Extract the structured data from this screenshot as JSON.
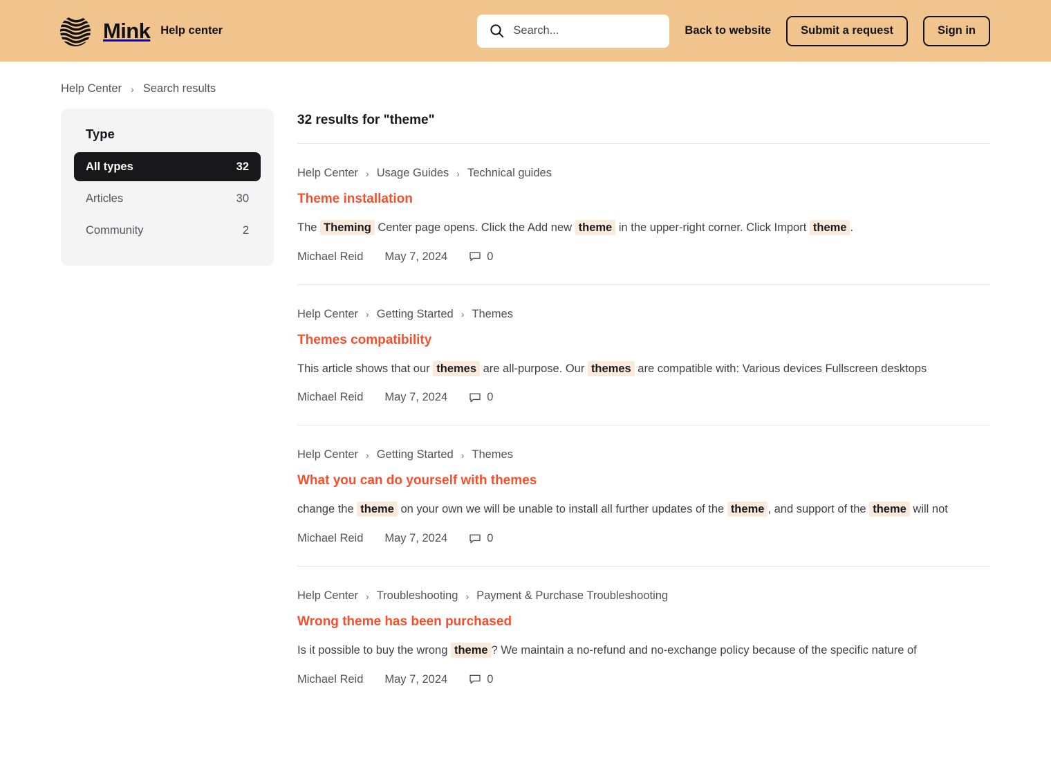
{
  "theme": {
    "header_bg": "#F2C48D",
    "accent_link": "#F4502D",
    "highlight_bg": "#FAEADB",
    "active_facet_bg": "#18181B",
    "sidebar_bg": "#F4F4F5",
    "divider": "#E4E4E7"
  },
  "header": {
    "brand_name": "Mink",
    "brand_logo_icon": "mink-wave-globe-logo",
    "help_center_label": "Help center",
    "search": {
      "icon": "search-icon",
      "placeholder": "Search...",
      "value": ""
    },
    "back_to_website_label": "Back to website",
    "submit_request_label": "Submit a request",
    "sign_in_label": "Sign in"
  },
  "breadcrumb": {
    "items": [
      {
        "label": "Help Center"
      },
      {
        "label": "Search results"
      }
    ],
    "separator": "›"
  },
  "sidebar": {
    "title": "Type",
    "facets": [
      {
        "label": "All types",
        "count": "32",
        "active": true
      },
      {
        "label": "Articles",
        "count": "30",
        "active": false
      },
      {
        "label": "Community",
        "count": "2",
        "active": false
      }
    ]
  },
  "results": {
    "heading": "32 results for \"theme\"",
    "items": [
      {
        "breadcrumb": [
          "Help Center",
          "Usage Guides",
          "Technical guides"
        ],
        "title": "Theme installation",
        "snippet": [
          {
            "t": "The ",
            "hl": false
          },
          {
            "t": "Theming",
            "hl": true
          },
          {
            "t": " Center page opens. Click the Add new ",
            "hl": false
          },
          {
            "t": "theme",
            "hl": true
          },
          {
            "t": " in the upper-right corner. Click Import ",
            "hl": false
          },
          {
            "t": "theme",
            "hl": true
          },
          {
            "t": ".",
            "hl": false
          }
        ],
        "author": "Michael Reid",
        "date": "May 7, 2024",
        "comment_icon": "comment-bubble-icon",
        "comments": "0"
      },
      {
        "breadcrumb": [
          "Help Center",
          "Getting Started",
          "Themes"
        ],
        "title": "Themes compatibility",
        "snippet": [
          {
            "t": "This article shows that our ",
            "hl": false
          },
          {
            "t": "themes",
            "hl": true
          },
          {
            "t": " are all-purpose. Our ",
            "hl": false
          },
          {
            "t": "themes",
            "hl": true
          },
          {
            "t": " are compatible with: Various devices Fullscreen desktops",
            "hl": false
          }
        ],
        "author": "Michael Reid",
        "date": "May 7, 2024",
        "comment_icon": "comment-bubble-icon",
        "comments": "0"
      },
      {
        "breadcrumb": [
          "Help Center",
          "Getting Started",
          "Themes"
        ],
        "title": "What you can do yourself with themes",
        "snippet": [
          {
            "t": "change the ",
            "hl": false
          },
          {
            "t": "theme",
            "hl": true
          },
          {
            "t": " on your own we will be unable to install all further updates of the ",
            "hl": false
          },
          {
            "t": "theme",
            "hl": true
          },
          {
            "t": ", and support of the ",
            "hl": false
          },
          {
            "t": "theme",
            "hl": true
          },
          {
            "t": " will not",
            "hl": false
          }
        ],
        "author": "Michael Reid",
        "date": "May 7, 2024",
        "comment_icon": "comment-bubble-icon",
        "comments": "0"
      },
      {
        "breadcrumb": [
          "Help Center",
          "Troubleshooting",
          "Payment & Purchase Troubleshooting"
        ],
        "title": "Wrong theme has been purchased",
        "snippet": [
          {
            "t": "Is it possible to buy the wrong ",
            "hl": false
          },
          {
            "t": "theme",
            "hl": true
          },
          {
            "t": "? We maintain a no-refund and no-exchange policy because of the specific nature of",
            "hl": false
          }
        ],
        "author": "Michael Reid",
        "date": "May 7, 2024",
        "comment_icon": "comment-bubble-icon",
        "comments": "0"
      }
    ]
  }
}
